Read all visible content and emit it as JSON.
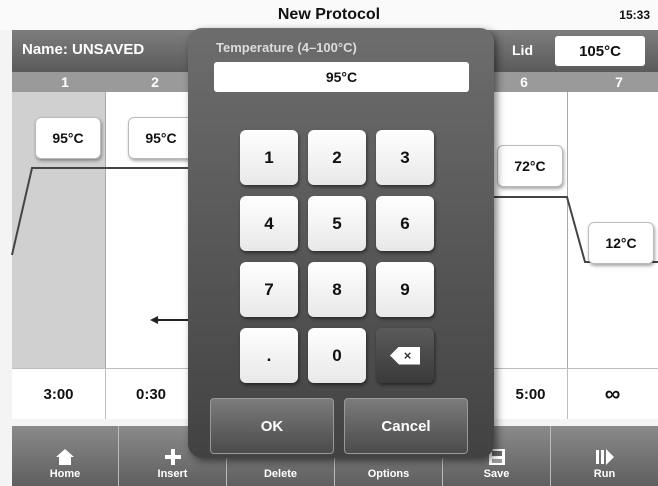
{
  "titlebar": {
    "title": "New Protocol",
    "clock": "15:33"
  },
  "header": {
    "name": "Name: UNSAVED",
    "lid_label": "Lid",
    "lid_value": "105°C"
  },
  "steps": {
    "numbers": [
      "1",
      "2",
      "6",
      "7"
    ]
  },
  "temps": {
    "s1": "95°C",
    "s2": "95°C",
    "s6": "72°C",
    "s7": "12°C"
  },
  "times": {
    "s1": "3:00",
    "s2": "0:30",
    "s6": "5:00",
    "s7": "∞"
  },
  "keypad": {
    "label": "Temperature (4–100°C)",
    "value": "95°C",
    "keys": [
      "1",
      "2",
      "3",
      "4",
      "5",
      "6",
      "7",
      "8",
      "9",
      ".",
      "0"
    ],
    "backspace": "×",
    "ok": "OK",
    "cancel": "Cancel"
  },
  "toolbar": {
    "home": "Home",
    "insert": "Insert",
    "delete": "Delete",
    "options": "Options",
    "save": "Save",
    "run": "Run"
  }
}
